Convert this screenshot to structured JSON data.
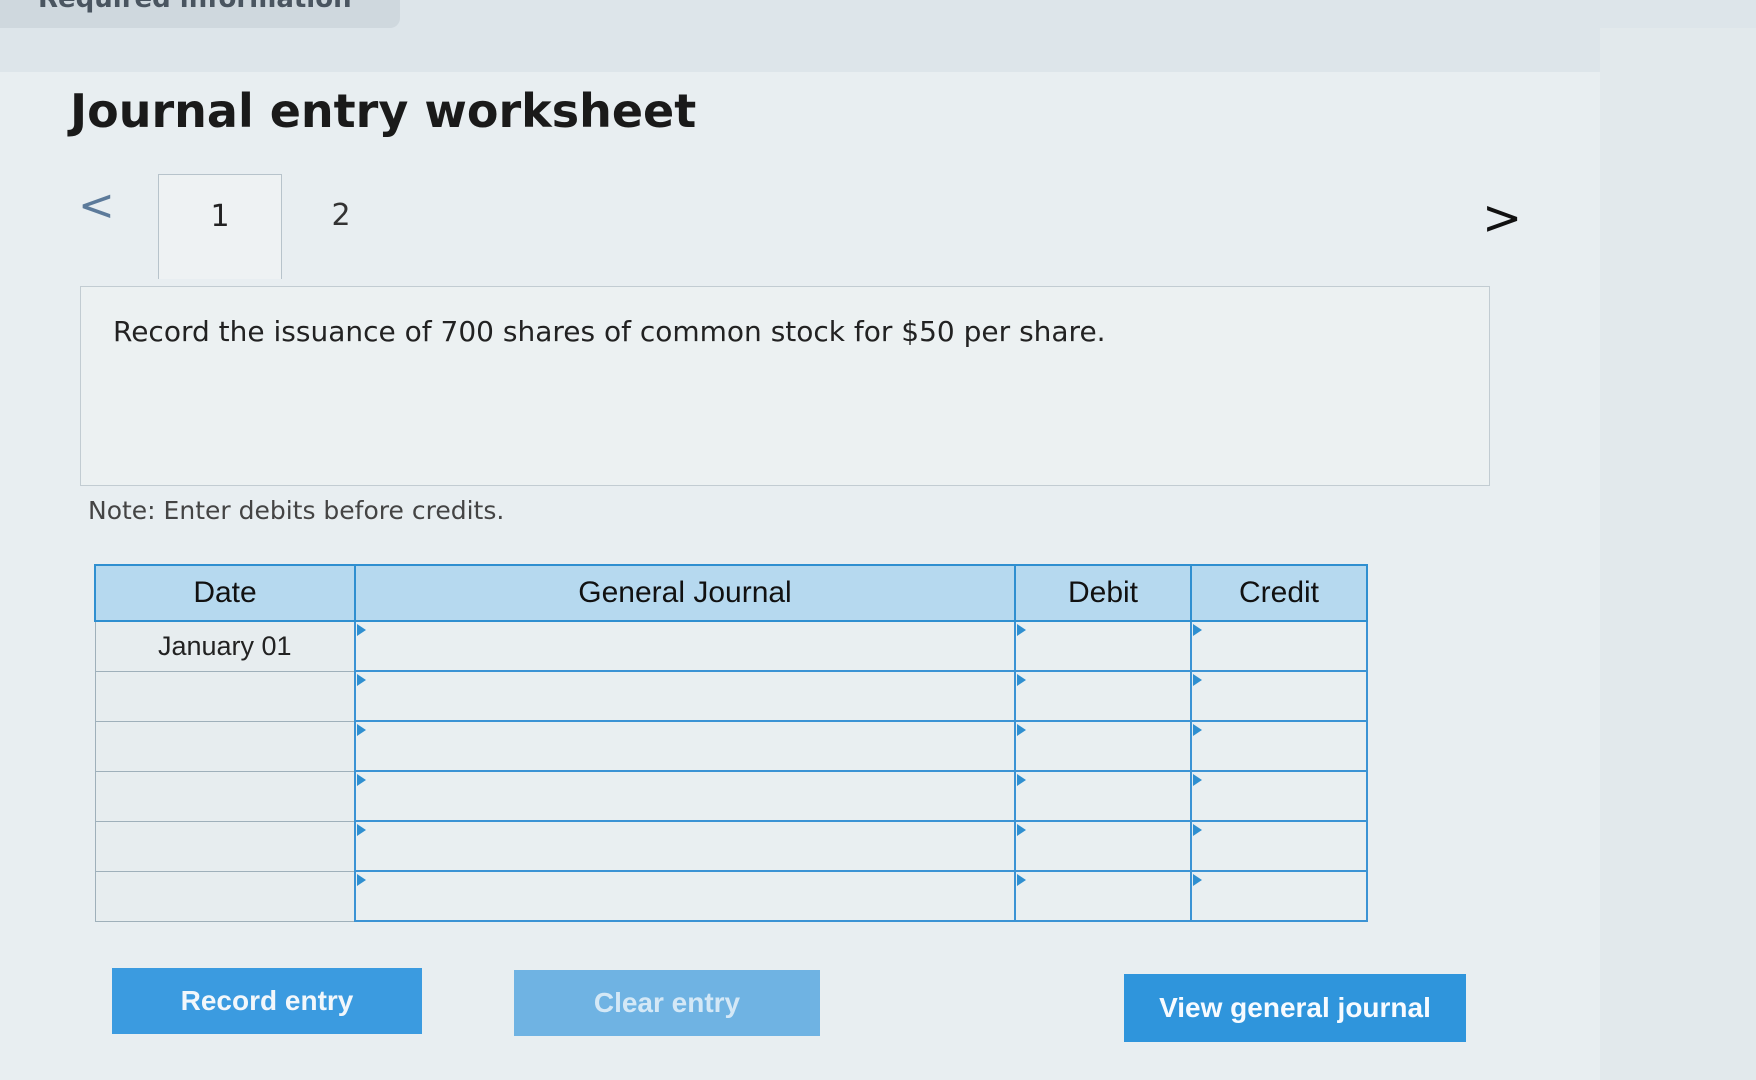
{
  "top_tab": {
    "label": "Required information"
  },
  "worksheet": {
    "title": "Journal entry worksheet",
    "nav_prev_glyph": "<",
    "nav_next_glyph": ">",
    "tabs": [
      {
        "label": "1",
        "active": true
      },
      {
        "label": "2",
        "active": false
      }
    ],
    "prompt": "Record the issuance of 700 shares of common stock for $50 per share.",
    "note": "Note: Enter debits before credits."
  },
  "journal_table": {
    "headers": {
      "date": "Date",
      "general_journal": "General Journal",
      "debit": "Debit",
      "credit": "Credit"
    },
    "rows": [
      {
        "date": "January 01",
        "account": "",
        "debit": "",
        "credit": ""
      },
      {
        "date": "",
        "account": "",
        "debit": "",
        "credit": ""
      },
      {
        "date": "",
        "account": "",
        "debit": "",
        "credit": ""
      },
      {
        "date": "",
        "account": "",
        "debit": "",
        "credit": ""
      },
      {
        "date": "",
        "account": "",
        "debit": "",
        "credit": ""
      },
      {
        "date": "",
        "account": "",
        "debit": "",
        "credit": ""
      }
    ]
  },
  "buttons": {
    "record_entry": "Record entry",
    "clear_entry": "Clear entry",
    "view_general_journal": "View general journal"
  },
  "colors": {
    "header_fill": "#b6d9ef",
    "grid_accent": "#2f8fd0",
    "button_primary": "#3b9be0"
  }
}
